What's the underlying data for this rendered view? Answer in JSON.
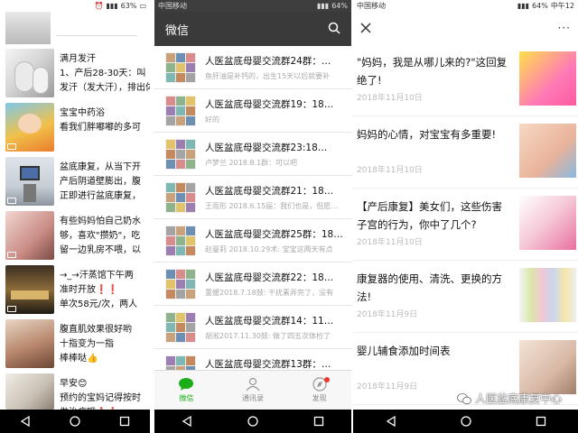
{
  "panel1": {
    "statusbar": {
      "battery": "63%"
    },
    "rows": [
      {
        "line1": "满月发汗",
        "line2": "1、产后28-30天：叫",
        "line3": "发汗（发大汗），排出体内"
      },
      {
        "line1": "宝宝中药浴",
        "line2": "看我们胖嘟嘟的多可"
      },
      {
        "line1": "盆底康复，从当下开",
        "line2": "产后阴道壁膨出，腹",
        "line3": "正即进行盆底康复，"
      },
      {
        "line1": "有些妈妈怕自己奶水",
        "line2": "够，喜欢\"攒奶\"，吃",
        "line3": "留一边乳房不喂，以"
      },
      {
        "line1": "→_→汗蒸馆下午两",
        "line2": "准时开放❗❗",
        "line3": "单次58元/次，两人"
      },
      {
        "line1": "腹直肌效果很好哟",
        "line2": "十指变为一指",
        "line3": "棒棒哒👍"
      },
      {
        "line1": "早安😊",
        "line2": "预约的宝妈记得按时",
        "line3": "做治疗哦❗❗"
      }
    ]
  },
  "panel2": {
    "statusbar": {
      "carrier": "中国移动",
      "battery": "64%"
    },
    "header": {
      "title": "微信"
    },
    "chats": [
      {
        "name": "人医盆底母婴交流群24群：…",
        "msg": "鱼肝油是补钙的，出生15天以后就要补"
      },
      {
        "name": "人医盆底母婴交流群19：18…",
        "msg": "好的"
      },
      {
        "name": "人医盆底母婴交流群23:18…",
        "msg": "卢梦兰 2018.8.1群：可以吧"
      },
      {
        "name": "人医盆底母婴交流群21：18…",
        "msg": "王雨形 2018.6.15届：我们也是，但愿…"
      },
      {
        "name": "人医盆底母婴交流群25群：18…",
        "msg": "赵曼莉 2018.10.29术: 宝宝这两天有点"
      },
      {
        "name": "人医盆底母婴交流群22：18…",
        "msg": "董媛2018.7.18鼓: 干扰素弄完了，没有"
      },
      {
        "name": "人医盆底母婴交流群14：11…",
        "msg": "胡淞2017.11.30鼓: 做了四五次体检了"
      },
      {
        "name": "人医盆底母婴交流群13群：…",
        "msg": ""
      }
    ],
    "tabs": [
      {
        "label": "微信"
      },
      {
        "label": "通讯录"
      },
      {
        "label": "发现"
      }
    ]
  },
  "panel3": {
    "statusbar": {
      "carrier": "中国移动",
      "battery": "64%",
      "time": "中午12"
    },
    "articles": [
      {
        "title": "\"妈妈，我是从哪儿来的?\"这回复绝了!",
        "date": "2018年11月10日"
      },
      {
        "title": "妈妈的心情，对宝宝有多重要!",
        "date": "2018年11月10日"
      },
      {
        "title": "【产后康复】美女们，这些伤害子宫的行为，你中了几个?",
        "date": "2018年11月10日"
      },
      {
        "title": "康复器的使用、清洗、更换的方法!",
        "date": "2018年11月9日"
      },
      {
        "title": "婴儿辅食添加时间表",
        "date": "2018年11月9日"
      }
    ],
    "watermark": "人医盆底康复中心"
  }
}
